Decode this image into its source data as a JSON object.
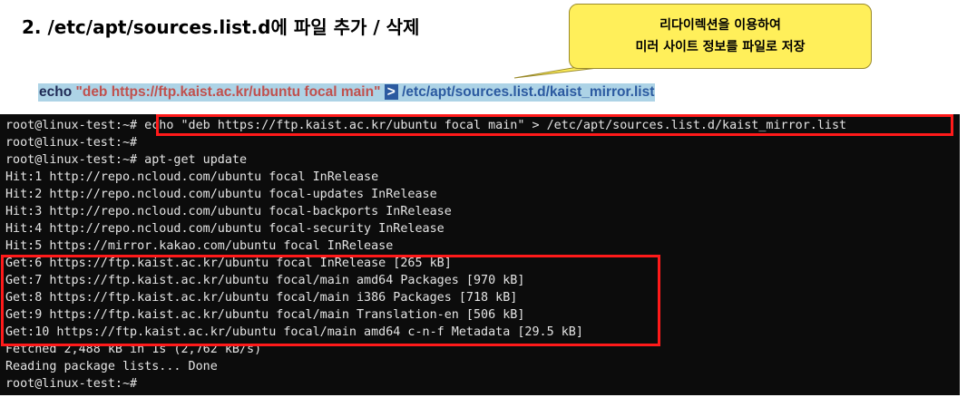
{
  "title": "2. /etc/apt/sources.list.d에 파일 추가 / 삭제",
  "callout": {
    "line1": "리다이렉션을 이용하여",
    "line2": "미러 사이트 정보를 파일로 저장"
  },
  "command": {
    "echo": "echo",
    "string": "\"deb https://ftp.kaist.ac.kr/ubuntu focal main\"",
    "redirect": ">",
    "path": "/etc/apt/sources.list.d/kaist_mirror.list"
  },
  "terminal": {
    "lines": [
      "root@linux-test:~# echo \"deb https://ftp.kaist.ac.kr/ubuntu focal main\" > /etc/apt/sources.list.d/kaist_mirror.list",
      "root@linux-test:~#",
      "root@linux-test:~# apt-get update",
      "Hit:1 http://repo.ncloud.com/ubuntu focal InRelease",
      "Hit:2 http://repo.ncloud.com/ubuntu focal-updates InRelease",
      "Hit:3 http://repo.ncloud.com/ubuntu focal-backports InRelease",
      "Hit:4 http://repo.ncloud.com/ubuntu focal-security InRelease",
      "Hit:5 https://mirror.kakao.com/ubuntu focal InRelease",
      "Get:6 https://ftp.kaist.ac.kr/ubuntu focal InRelease [265 kB]",
      "Get:7 https://ftp.kaist.ac.kr/ubuntu focal/main amd64 Packages [970 kB]",
      "Get:8 https://ftp.kaist.ac.kr/ubuntu focal/main i386 Packages [718 kB]",
      "Get:9 https://ftp.kaist.ac.kr/ubuntu focal/main Translation-en [506 kB]",
      "Get:10 https://ftp.kaist.ac.kr/ubuntu focal/main amd64 c-n-f Metadata [29.5 kB]",
      "Fetched 2,488 kB in 1s (2,762 kB/s)",
      "Reading package lists... Done",
      "root@linux-test:~#"
    ]
  },
  "colors": {
    "highlight": "#ff1a1a",
    "callout_bg": "#ffef5a",
    "terminal_bg": "#0c0c0c",
    "terminal_fg": "#e4e4e4"
  }
}
